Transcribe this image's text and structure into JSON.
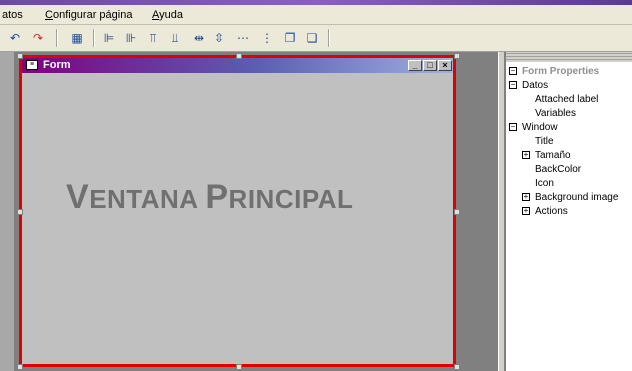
{
  "menu": {
    "items": [
      "atos",
      "Configurar página",
      "Ayuda"
    ]
  },
  "form": {
    "title": "Form",
    "caption_first_V": "V",
    "caption_rest_1": "ENTANA ",
    "caption_first_P": "P",
    "caption_rest_2": "RINCIPAL"
  },
  "properties": {
    "title": "Form Properties",
    "rows": [
      {
        "label": "Datos",
        "expander": "⊟"
      },
      {
        "label": "Attached label"
      },
      {
        "label": "Variables"
      },
      {
        "label": "Window",
        "expander": "⊟"
      },
      {
        "label": "Title"
      },
      {
        "label": "Tamaño",
        "expander": "⊞"
      },
      {
        "label": "BackColor"
      },
      {
        "label": "Icon"
      },
      {
        "label": "Background image",
        "expander": "⊞"
      },
      {
        "label": "Actions",
        "expander": "⊞"
      }
    ]
  },
  "colors": {
    "selection_border": "#e00000",
    "title_gradient_start": "#800080",
    "canvas": "#c0c0c0"
  }
}
